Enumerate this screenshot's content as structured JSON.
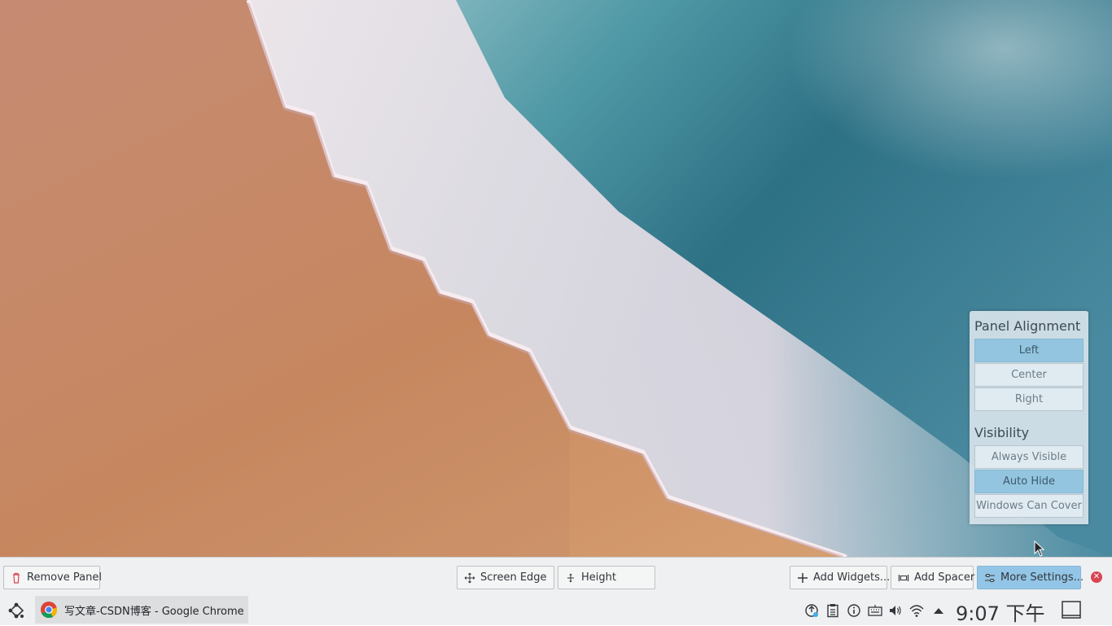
{
  "popup": {
    "alignment_title": "Panel Alignment",
    "alignment_options": [
      "Left",
      "Center",
      "Right"
    ],
    "alignment_selected": "Left",
    "visibility_title": "Visibility",
    "visibility_options": [
      "Always Visible",
      "Auto Hide",
      "Windows Can Cover"
    ],
    "visibility_selected": "Auto Hide"
  },
  "controller": {
    "remove_panel": "Remove Panel",
    "screen_edge": "Screen Edge",
    "height": "Height",
    "add_widgets": "Add Widgets...",
    "add_spacer": "Add Spacer",
    "more_settings": "More Settings..."
  },
  "taskbar": {
    "task_title": "写文章-CSDN博客 - Google Chrome",
    "clock": "9:07 下午"
  },
  "colors": {
    "accent": "#93c5e6",
    "close": "#da4453",
    "panel_bg": "#eff0f1"
  }
}
